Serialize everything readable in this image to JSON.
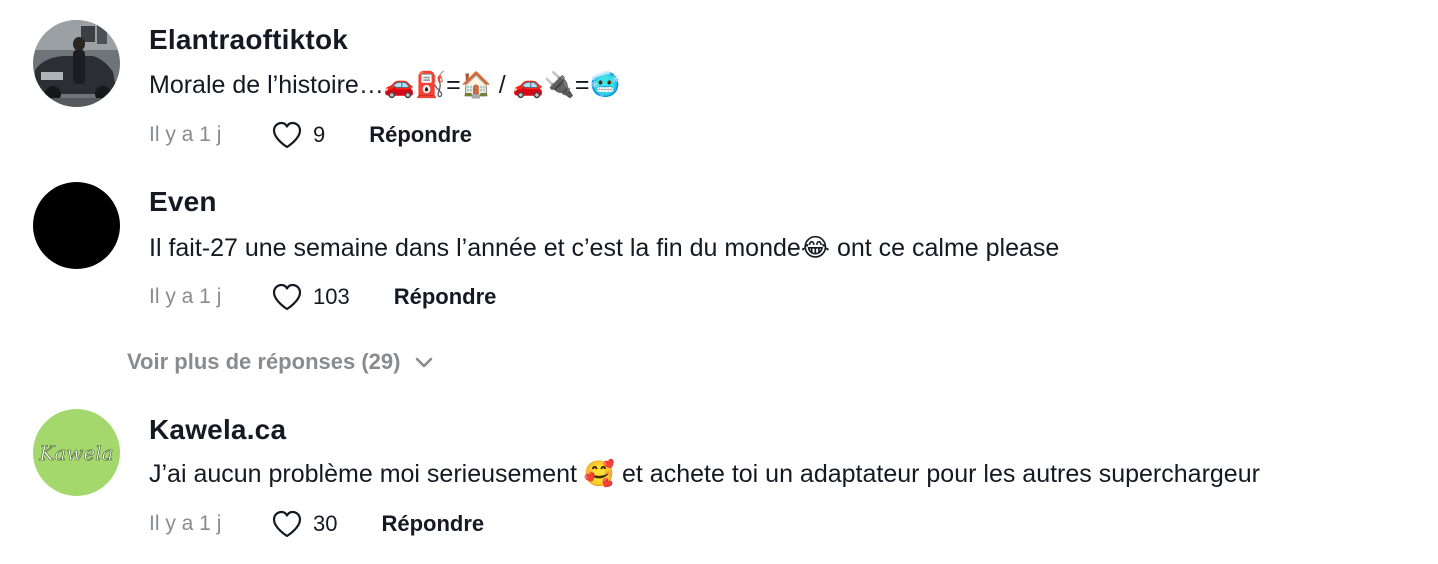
{
  "comments": [
    {
      "username": "Elantraoftiktok",
      "text": "Morale de l’histoire…🚗⛽️=🏠 / 🚗🔌=🥶",
      "time": "Il y a 1 j",
      "likes": "9",
      "reply_label": "Répondre",
      "avatar": "photo-car-person"
    },
    {
      "username": "Even",
      "text": "Il fait-27 une semaine dans l’année et c’est la fin du monde😂 ont ce calme please",
      "time": "Il y a 1 j",
      "likes": "103",
      "reply_label": "Répondre",
      "avatar": "black-circle"
    },
    {
      "username": "Kawela.ca",
      "text": "J’ai aucun problème moi serieusement 🥰 et achete toi un adaptateur pour les autres superchargeur",
      "time": "Il y a 1 j",
      "likes": "30",
      "reply_label": "Répondre",
      "avatar": "kawela-logo",
      "avatar_logo_text": "Kawela"
    }
  ],
  "more_replies": {
    "label": "Voir plus de réponses (29)",
    "icon": "chevron-down-icon"
  },
  "colors": {
    "text": "#161823",
    "muted": "#8a8b91",
    "kawela_green": "#a5d86c"
  }
}
